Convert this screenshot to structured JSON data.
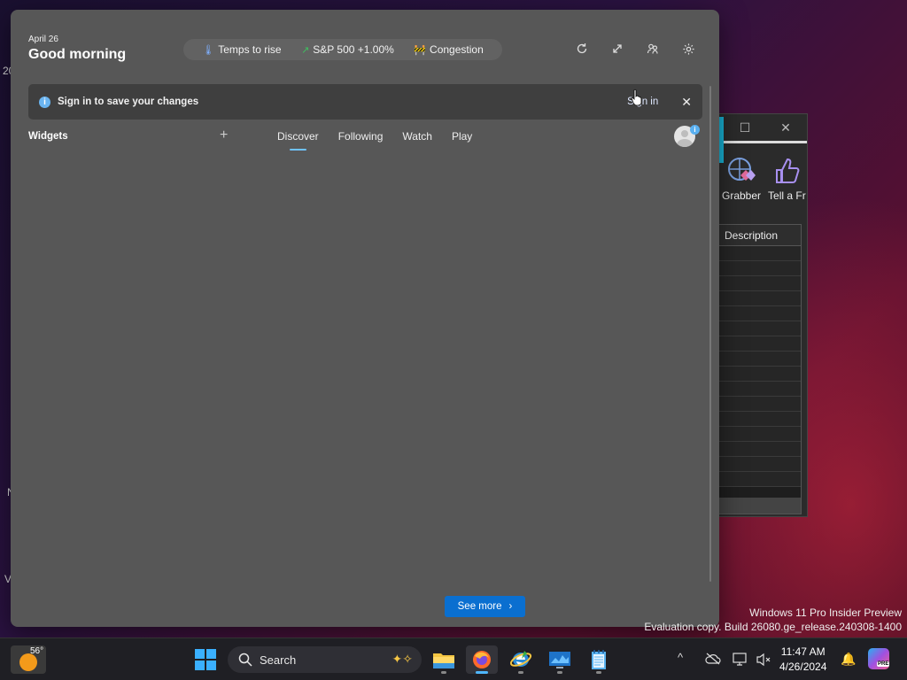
{
  "desktop": {
    "fragments": [
      "20",
      "N",
      "V"
    ],
    "watermark_line1": "Windows 11 Pro Insider Preview",
    "watermark_line2": "Evaluation copy. Build 26080.ge_release.240308-1400"
  },
  "background_window": {
    "ribbon": [
      {
        "label": "Grabber",
        "icon": "grabber-icon"
      },
      {
        "label": "Tell a Fr",
        "icon": "thumbs-up-icon"
      }
    ],
    "column_header": "Description"
  },
  "widgets": {
    "date": "April 26",
    "greeting": "Good morning",
    "chips": [
      {
        "icon": "thermometer-icon",
        "glyph": "🌡",
        "label": "Temps to rise",
        "color": "#7fb0ff"
      },
      {
        "icon": "trend-up-icon",
        "glyph": "↗",
        "label": "S&P 500 +1.00%",
        "color": "#3fbf5f"
      },
      {
        "icon": "traffic-icon",
        "glyph": "🚧",
        "label": "Congestion",
        "color": "#ff8a3a"
      }
    ],
    "banner": {
      "message": "Sign in to save your changes",
      "action": "Sign in"
    },
    "title": "Widgets",
    "tabs": [
      "Discover",
      "Following",
      "Watch",
      "Play"
    ],
    "active_tab": "Discover",
    "see_more": "See more"
  },
  "taskbar": {
    "temperature": "56°",
    "search_label": "Search",
    "time": "11:47 AM",
    "date": "4/26/2024",
    "apps": [
      "file-explorer-icon",
      "firefox-icon",
      "internet-explorer-icon",
      "monitor-app-icon",
      "notepad-icon"
    ],
    "copilot_badge": "PRE"
  }
}
